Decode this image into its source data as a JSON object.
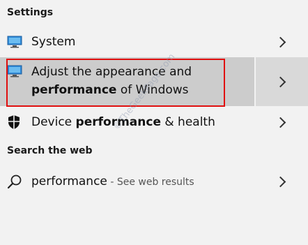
{
  "settings": {
    "header": "Settings",
    "items": [
      {
        "label_plain": "System"
      },
      {
        "line1": "Adjust the appearance and",
        "line2_bold": "performance",
        "line2_rest": " of Windows"
      },
      {
        "label_plain": "Device ",
        "label_bold": "performance",
        "label_rest": " & health"
      }
    ]
  },
  "web": {
    "header": "Search the web",
    "query": "performance",
    "suffix": " - See web results"
  },
  "watermark": "©TheGeekPage.com",
  "colors": {
    "highlight": "#cccccc",
    "annotation_box": "#e01010",
    "monitor_icon": "#2f8ad8"
  }
}
